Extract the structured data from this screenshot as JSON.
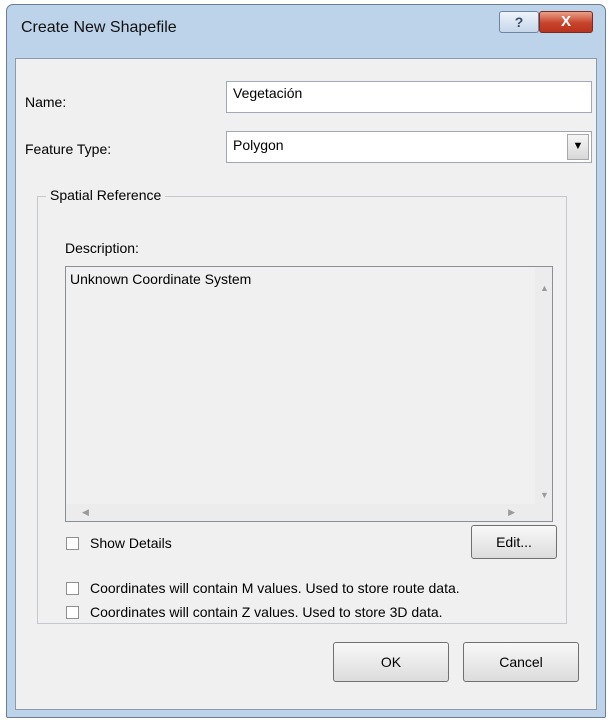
{
  "window": {
    "title": "Create New Shapefile",
    "help_glyph": "?",
    "close_glyph": "X"
  },
  "form": {
    "name_label": "Name:",
    "name_value": "Vegetación",
    "feature_type_label": "Feature Type:",
    "feature_type_value": "Polygon",
    "feature_type_arrow": "▼"
  },
  "spatial_reference": {
    "legend": "Spatial Reference",
    "description_label": "Description:",
    "description_text": "Unknown Coordinate System",
    "show_details_label": "Show Details",
    "show_details_checked": false,
    "edit_button_label": "Edit..."
  },
  "options": {
    "m_values_label": "Coordinates will contain M values. Used to store route data.",
    "m_values_checked": false,
    "z_values_label": "Coordinates will contain Z values. Used to store 3D data.",
    "z_values_checked": false
  },
  "buttons": {
    "ok_label": "OK",
    "cancel_label": "Cancel"
  },
  "colors": {
    "frame": "#bcd3ea",
    "client_background": "#f0f0f0",
    "close_button": "#c7432b"
  }
}
